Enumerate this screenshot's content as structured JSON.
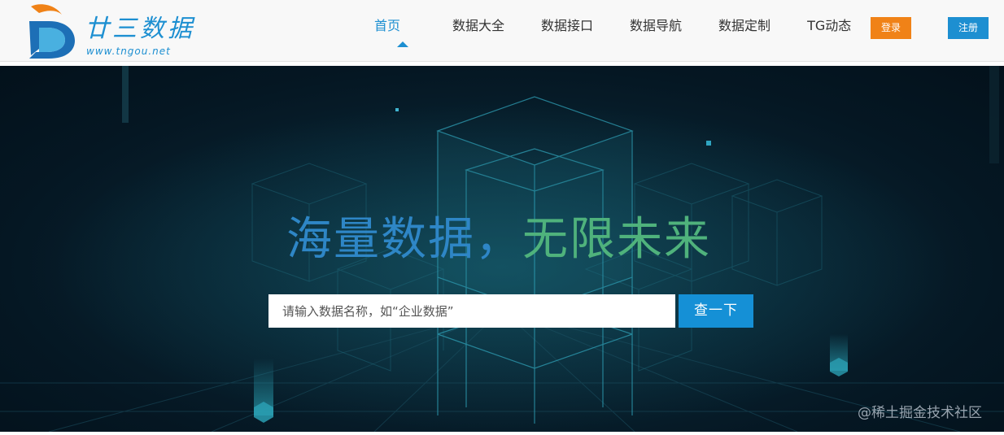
{
  "header": {
    "logo": {
      "title": "廿三数据",
      "domain": "www.tngou.net",
      "colors": {
        "orange": "#f08217",
        "blue": "#1d8fd1"
      }
    },
    "nav": [
      {
        "label": "首页",
        "active": true
      },
      {
        "label": "数据大全",
        "active": false
      },
      {
        "label": "数据接口",
        "active": false
      },
      {
        "label": "数据导航",
        "active": false
      },
      {
        "label": "数据定制",
        "active": false
      },
      {
        "label": "TG动态",
        "active": false
      }
    ],
    "login_label": "登录",
    "register_label": "注册"
  },
  "banner": {
    "headline_part1": "海量数据，",
    "headline_part2": "无限未来",
    "search": {
      "placeholder": "请输入数据名称，如“企业数据”",
      "value": "",
      "button_label": "查一下"
    }
  },
  "watermark": "@稀土掘金技术社区",
  "colors": {
    "accent": "#1d8fd1",
    "login": "#f08217",
    "banner_bg": "#051723",
    "headline_blue": "#2e86c6",
    "headline_green": "#4fb27c"
  }
}
